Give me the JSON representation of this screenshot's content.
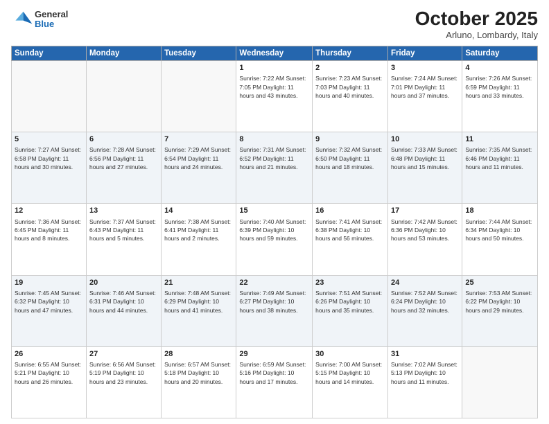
{
  "header": {
    "logo": {
      "general": "General",
      "blue": "Blue"
    },
    "title": "October 2025",
    "location": "Arluno, Lombardy, Italy"
  },
  "days_of_week": [
    "Sunday",
    "Monday",
    "Tuesday",
    "Wednesday",
    "Thursday",
    "Friday",
    "Saturday"
  ],
  "weeks": [
    [
      {
        "day": "",
        "info": ""
      },
      {
        "day": "",
        "info": ""
      },
      {
        "day": "",
        "info": ""
      },
      {
        "day": "1",
        "info": "Sunrise: 7:22 AM\nSunset: 7:05 PM\nDaylight: 11 hours and 43 minutes."
      },
      {
        "day": "2",
        "info": "Sunrise: 7:23 AM\nSunset: 7:03 PM\nDaylight: 11 hours and 40 minutes."
      },
      {
        "day": "3",
        "info": "Sunrise: 7:24 AM\nSunset: 7:01 PM\nDaylight: 11 hours and 37 minutes."
      },
      {
        "day": "4",
        "info": "Sunrise: 7:26 AM\nSunset: 6:59 PM\nDaylight: 11 hours and 33 minutes."
      }
    ],
    [
      {
        "day": "5",
        "info": "Sunrise: 7:27 AM\nSunset: 6:58 PM\nDaylight: 11 hours and 30 minutes."
      },
      {
        "day": "6",
        "info": "Sunrise: 7:28 AM\nSunset: 6:56 PM\nDaylight: 11 hours and 27 minutes."
      },
      {
        "day": "7",
        "info": "Sunrise: 7:29 AM\nSunset: 6:54 PM\nDaylight: 11 hours and 24 minutes."
      },
      {
        "day": "8",
        "info": "Sunrise: 7:31 AM\nSunset: 6:52 PM\nDaylight: 11 hours and 21 minutes."
      },
      {
        "day": "9",
        "info": "Sunrise: 7:32 AM\nSunset: 6:50 PM\nDaylight: 11 hours and 18 minutes."
      },
      {
        "day": "10",
        "info": "Sunrise: 7:33 AM\nSunset: 6:48 PM\nDaylight: 11 hours and 15 minutes."
      },
      {
        "day": "11",
        "info": "Sunrise: 7:35 AM\nSunset: 6:46 PM\nDaylight: 11 hours and 11 minutes."
      }
    ],
    [
      {
        "day": "12",
        "info": "Sunrise: 7:36 AM\nSunset: 6:45 PM\nDaylight: 11 hours and 8 minutes."
      },
      {
        "day": "13",
        "info": "Sunrise: 7:37 AM\nSunset: 6:43 PM\nDaylight: 11 hours and 5 minutes."
      },
      {
        "day": "14",
        "info": "Sunrise: 7:38 AM\nSunset: 6:41 PM\nDaylight: 11 hours and 2 minutes."
      },
      {
        "day": "15",
        "info": "Sunrise: 7:40 AM\nSunset: 6:39 PM\nDaylight: 10 hours and 59 minutes."
      },
      {
        "day": "16",
        "info": "Sunrise: 7:41 AM\nSunset: 6:38 PM\nDaylight: 10 hours and 56 minutes."
      },
      {
        "day": "17",
        "info": "Sunrise: 7:42 AM\nSunset: 6:36 PM\nDaylight: 10 hours and 53 minutes."
      },
      {
        "day": "18",
        "info": "Sunrise: 7:44 AM\nSunset: 6:34 PM\nDaylight: 10 hours and 50 minutes."
      }
    ],
    [
      {
        "day": "19",
        "info": "Sunrise: 7:45 AM\nSunset: 6:32 PM\nDaylight: 10 hours and 47 minutes."
      },
      {
        "day": "20",
        "info": "Sunrise: 7:46 AM\nSunset: 6:31 PM\nDaylight: 10 hours and 44 minutes."
      },
      {
        "day": "21",
        "info": "Sunrise: 7:48 AM\nSunset: 6:29 PM\nDaylight: 10 hours and 41 minutes."
      },
      {
        "day": "22",
        "info": "Sunrise: 7:49 AM\nSunset: 6:27 PM\nDaylight: 10 hours and 38 minutes."
      },
      {
        "day": "23",
        "info": "Sunrise: 7:51 AM\nSunset: 6:26 PM\nDaylight: 10 hours and 35 minutes."
      },
      {
        "day": "24",
        "info": "Sunrise: 7:52 AM\nSunset: 6:24 PM\nDaylight: 10 hours and 32 minutes."
      },
      {
        "day": "25",
        "info": "Sunrise: 7:53 AM\nSunset: 6:22 PM\nDaylight: 10 hours and 29 minutes."
      }
    ],
    [
      {
        "day": "26",
        "info": "Sunrise: 6:55 AM\nSunset: 5:21 PM\nDaylight: 10 hours and 26 minutes."
      },
      {
        "day": "27",
        "info": "Sunrise: 6:56 AM\nSunset: 5:19 PM\nDaylight: 10 hours and 23 minutes."
      },
      {
        "day": "28",
        "info": "Sunrise: 6:57 AM\nSunset: 5:18 PM\nDaylight: 10 hours and 20 minutes."
      },
      {
        "day": "29",
        "info": "Sunrise: 6:59 AM\nSunset: 5:16 PM\nDaylight: 10 hours and 17 minutes."
      },
      {
        "day": "30",
        "info": "Sunrise: 7:00 AM\nSunset: 5:15 PM\nDaylight: 10 hours and 14 minutes."
      },
      {
        "day": "31",
        "info": "Sunrise: 7:02 AM\nSunset: 5:13 PM\nDaylight: 10 hours and 11 minutes."
      },
      {
        "day": "",
        "info": ""
      }
    ]
  ]
}
